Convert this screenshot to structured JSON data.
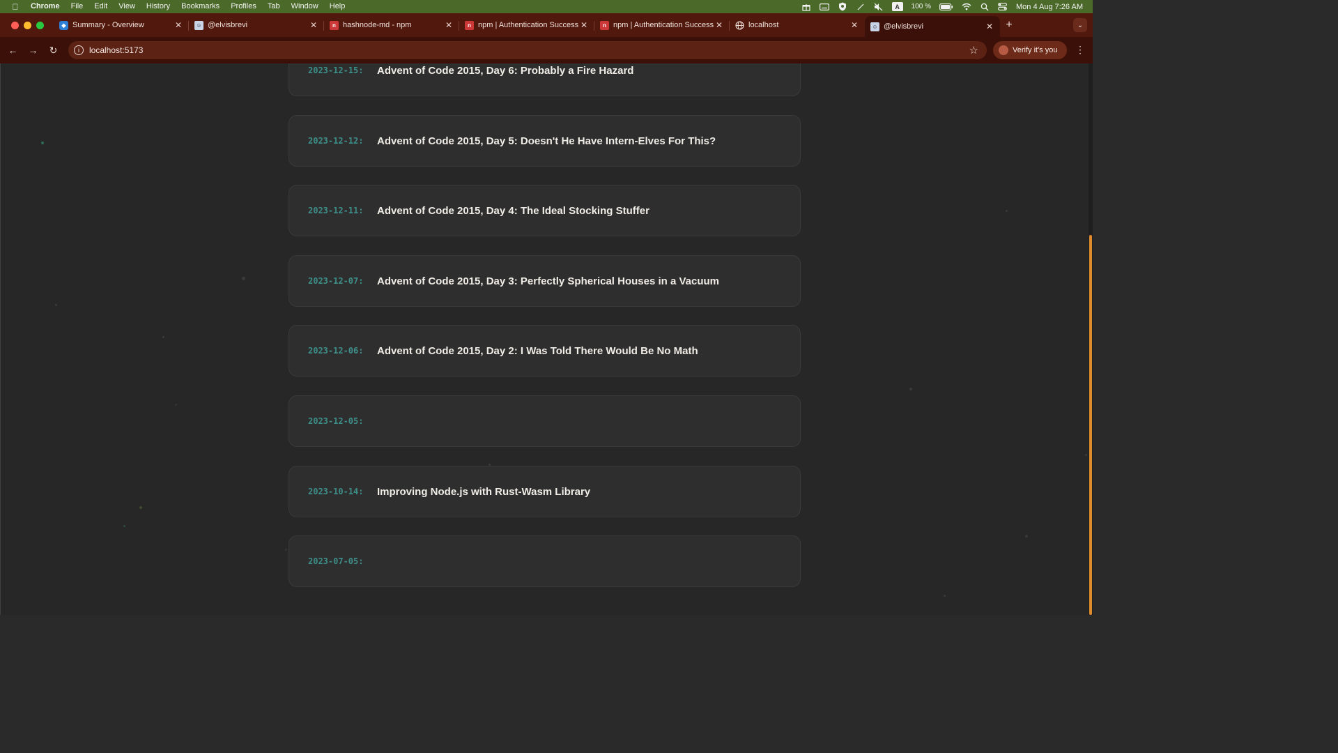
{
  "menubar": {
    "app": "Chrome",
    "items": [
      "File",
      "Edit",
      "View",
      "History",
      "Bookmarks",
      "Profiles",
      "Tab",
      "Window",
      "Help"
    ],
    "battery": "100 %",
    "input_source": "A",
    "datetime": "Mon 4 Aug  7:26 AM"
  },
  "tabs": [
    {
      "title": "Summary - Overview",
      "icon": "azure-devops-icon"
    },
    {
      "title": "@elvisbrevi",
      "icon": "avatar-icon"
    },
    {
      "title": "hashnode-md - npm",
      "icon": "npm-icon"
    },
    {
      "title": "npm | Authentication Success",
      "icon": "npm-icon"
    },
    {
      "title": "npm | Authentication Success",
      "icon": "npm-icon"
    },
    {
      "title": "localhost",
      "icon": "globe-icon"
    },
    {
      "title": "@elvisbrevi",
      "icon": "avatar-icon",
      "active": true
    }
  ],
  "toolbar": {
    "url": "localhost:5173",
    "verify_label": "Verify it's you"
  },
  "posts": [
    {
      "date": "2023-12-15:",
      "title": "Advent of Code 2015, Day 6: Probably a Fire Hazard"
    },
    {
      "date": "2023-12-12:",
      "title": "Advent of Code 2015, Day 5: Doesn't He Have Intern-Elves For This?"
    },
    {
      "date": "2023-12-11:",
      "title": "Advent of Code 2015, Day 4: The Ideal Stocking Stuffer"
    },
    {
      "date": "2023-12-07:",
      "title": "Advent of Code 2015, Day 3: Perfectly Spherical Houses in a Vacuum"
    },
    {
      "date": "2023-12-06:",
      "title": "Advent of Code 2015, Day 2: I Was Told There Would Be No Math"
    },
    {
      "date": "2023-12-05:",
      "title": ""
    },
    {
      "date": "2023-10-14:",
      "title": "Improving Node.js with Rust-Wasm Library"
    },
    {
      "date": "2023-07-05:",
      "title": ""
    }
  ],
  "colors": {
    "tabstrip": "#51180d",
    "toolbar": "#3a1008",
    "date_accent": "#3e8f8a",
    "scroll_accent": "#e08a2e"
  }
}
